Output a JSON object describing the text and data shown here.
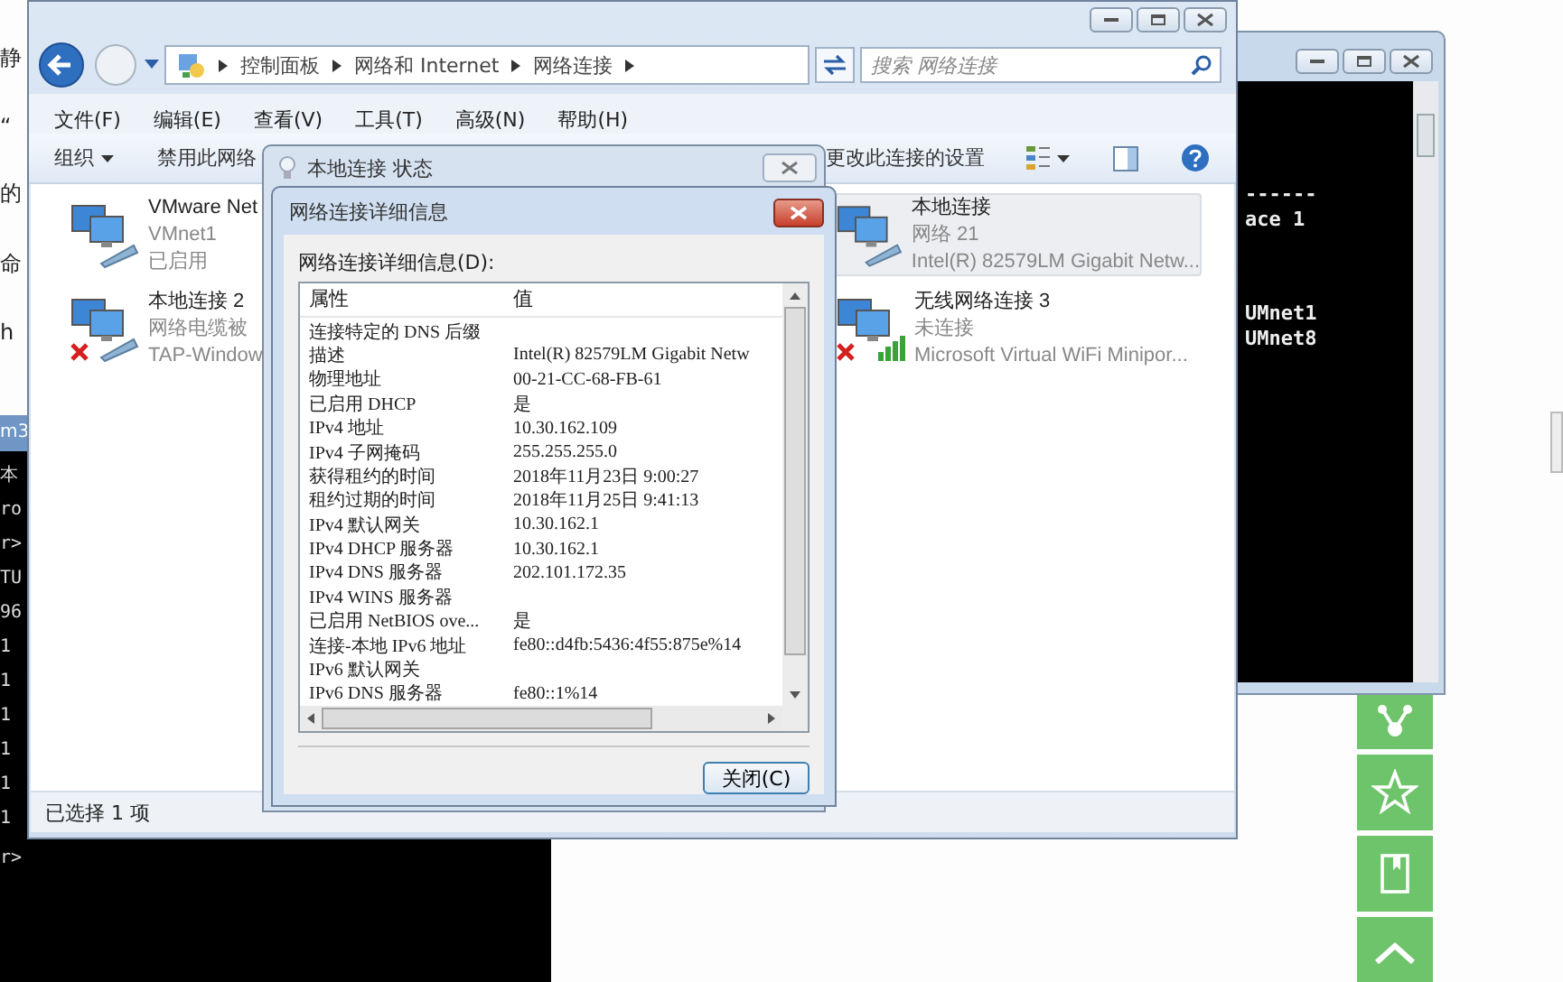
{
  "background_page": {
    "left_fragments": [
      "静",
      "“",
      "的",
      "命",
      "h"
    ]
  },
  "left_console": {
    "title": "m3",
    "lines": [
      "本",
      "ro",
      "r>",
      "TU",
      "96",
      "1",
      "1",
      "1",
      "1",
      "1",
      "1"
    ],
    "prompt": "r>"
  },
  "right_console": {
    "lines": [
      "------",
      "ace 1",
      "UMnet1",
      "UMnet8"
    ]
  },
  "explorer": {
    "breadcrumb": [
      "控制面板",
      "网络和 Internet",
      "网络连接"
    ],
    "search": {
      "placeholder": "搜索 网络连接"
    },
    "menu": [
      "文件(F)",
      "编辑(E)",
      "查看(V)",
      "工具(T)",
      "高级(N)",
      "帮助(H)"
    ],
    "toolbar": {
      "organize": "组织",
      "disable": "禁用此网络",
      "change": "更改此连接的设置"
    },
    "connections": [
      {
        "name": "VMware Net",
        "line2": "VMnet1",
        "line3": "已启用",
        "kind": "wired",
        "error": false,
        "selected": false
      },
      {
        "name": "本地连接",
        "line2": "网络  21",
        "line3": "Intel(R) 82579LM Gigabit Netw...",
        "kind": "wired",
        "error": false,
        "selected": true
      },
      {
        "name": "本地连接 2",
        "line2": "网络电缆被",
        "line3": "TAP-Window",
        "kind": "wired",
        "error": true,
        "selected": false
      },
      {
        "name": "无线网络连接 3",
        "line2": "未连接",
        "line3": "Microsoft Virtual WiFi Minipor...",
        "kind": "wireless",
        "error": true,
        "selected": false
      }
    ],
    "status_bar": "已选择 1 项"
  },
  "status_dialog": {
    "title": "本地连接 状态"
  },
  "details_dialog": {
    "title": "网络连接详细信息",
    "label": "网络连接详细信息(D):",
    "columns": [
      "属性",
      "值"
    ],
    "rows": [
      {
        "property": "连接特定的 DNS 后缀",
        "value": ""
      },
      {
        "property": "描述",
        "value": "Intel(R) 82579LM Gigabit Netw"
      },
      {
        "property": "物理地址",
        "value": "00-21-CC-68-FB-61"
      },
      {
        "property": "已启用 DHCP",
        "value": "是"
      },
      {
        "property": "IPv4 地址",
        "value": "10.30.162.109"
      },
      {
        "property": "IPv4 子网掩码",
        "value": "255.255.255.0"
      },
      {
        "property": "获得租约的时间",
        "value": "2018年11月23日 9:00:27"
      },
      {
        "property": "租约过期的时间",
        "value": "2018年11月25日 9:41:13"
      },
      {
        "property": "IPv4 默认网关",
        "value": "10.30.162.1"
      },
      {
        "property": "IPv4 DHCP 服务器",
        "value": "10.30.162.1"
      },
      {
        "property": "IPv4 DNS 服务器",
        "value": "202.101.172.35"
      },
      {
        "property": "IPv4 WINS 服务器",
        "value": ""
      },
      {
        "property": "已启用 NetBIOS ove...",
        "value": "是"
      },
      {
        "property": "连接-本地 IPv6 地址",
        "value": "fe80::d4fb:5436:4f55:875e%14"
      },
      {
        "property": "IPv6 默认网关",
        "value": ""
      },
      {
        "property": "IPv6 DNS 服务器",
        "value": "fe80::1%14"
      }
    ],
    "close_button": "关闭(C)"
  },
  "side_buttons": [
    {
      "kind": "share"
    },
    {
      "kind": "star"
    },
    {
      "kind": "book"
    },
    {
      "kind": "top"
    }
  ]
}
